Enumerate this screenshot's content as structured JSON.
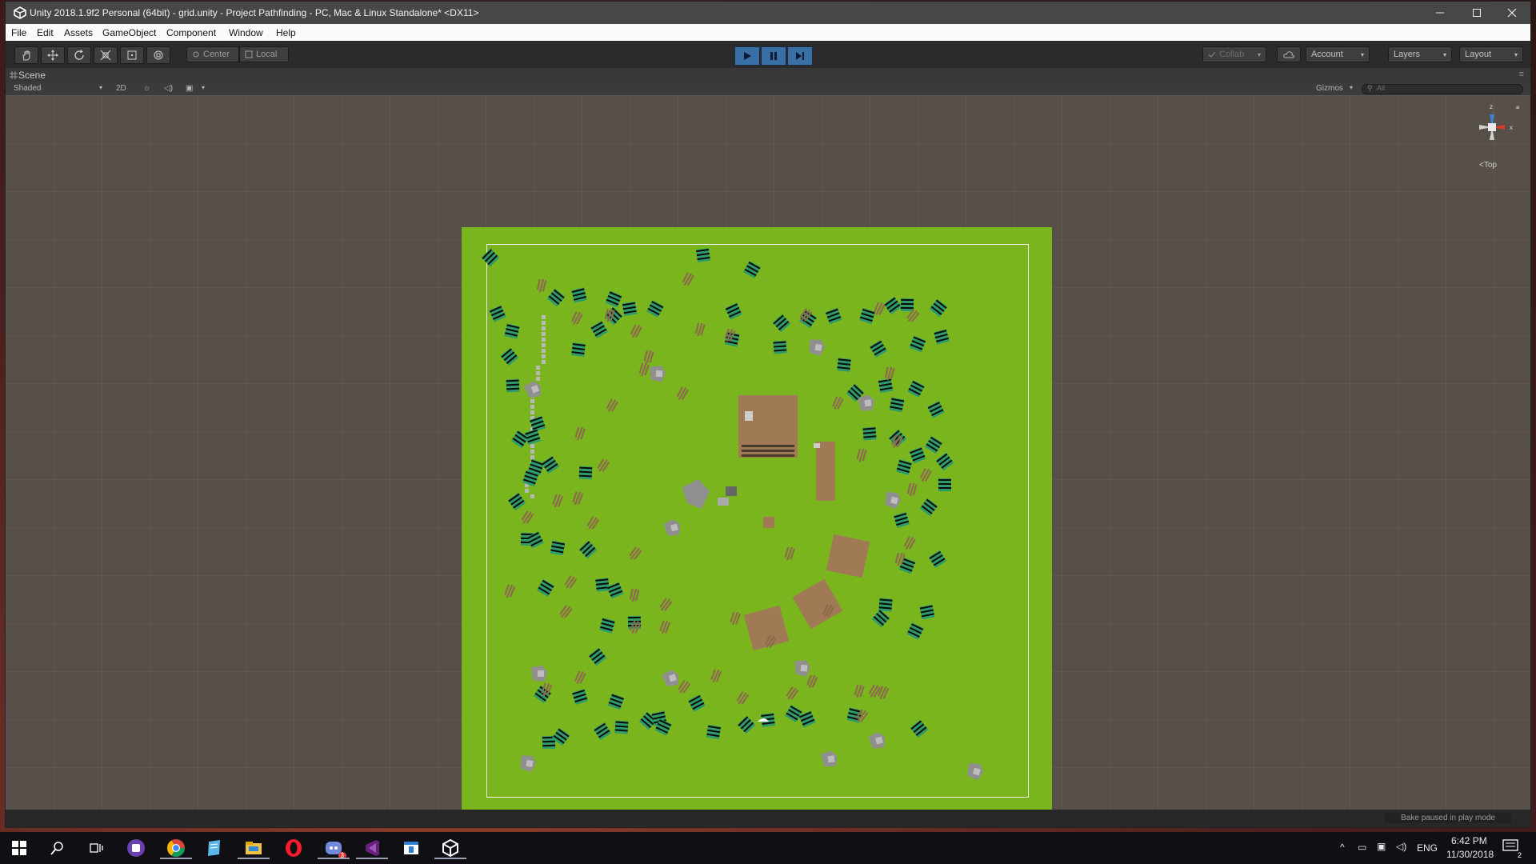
{
  "window": {
    "title": "Unity 2018.1.9f2 Personal (64bit) - grid.unity - Project Pathfinding - PC, Mac & Linux Standalone* <DX11>",
    "controls": [
      "minimize",
      "maximize",
      "close"
    ]
  },
  "menu": [
    "File",
    "Edit",
    "Assets",
    "GameObject",
    "Component",
    "Window",
    "Help"
  ],
  "toolbar": {
    "pivot_label": "Center",
    "space_label": "Local",
    "collab_label": "Collab",
    "account_label": "Account",
    "layers_label": "Layers",
    "layout_label": "Layout"
  },
  "scene": {
    "tab_label": "Scene",
    "shading_mode": "Shaded",
    "mode_2d": "2D",
    "gizmos_label": "Gizmos",
    "search_placeholder": "All",
    "gizmo_view_label": "Top",
    "axis_z": "z",
    "axis_x": "x"
  },
  "status": {
    "bake_message": "Bake paused in play mode"
  },
  "taskbar": {
    "time": "6:42 PM",
    "date": "11/30/2018",
    "language": "ENG",
    "notification_count": "2",
    "discord_badge": "3"
  },
  "colors": {
    "ground": "#7ab51e",
    "tree": "#2e9c6a",
    "bush": "#8c6a4a",
    "building": "#a07a54",
    "rock": "#8f8f8f",
    "play_accent": "#3a6fa6"
  }
}
